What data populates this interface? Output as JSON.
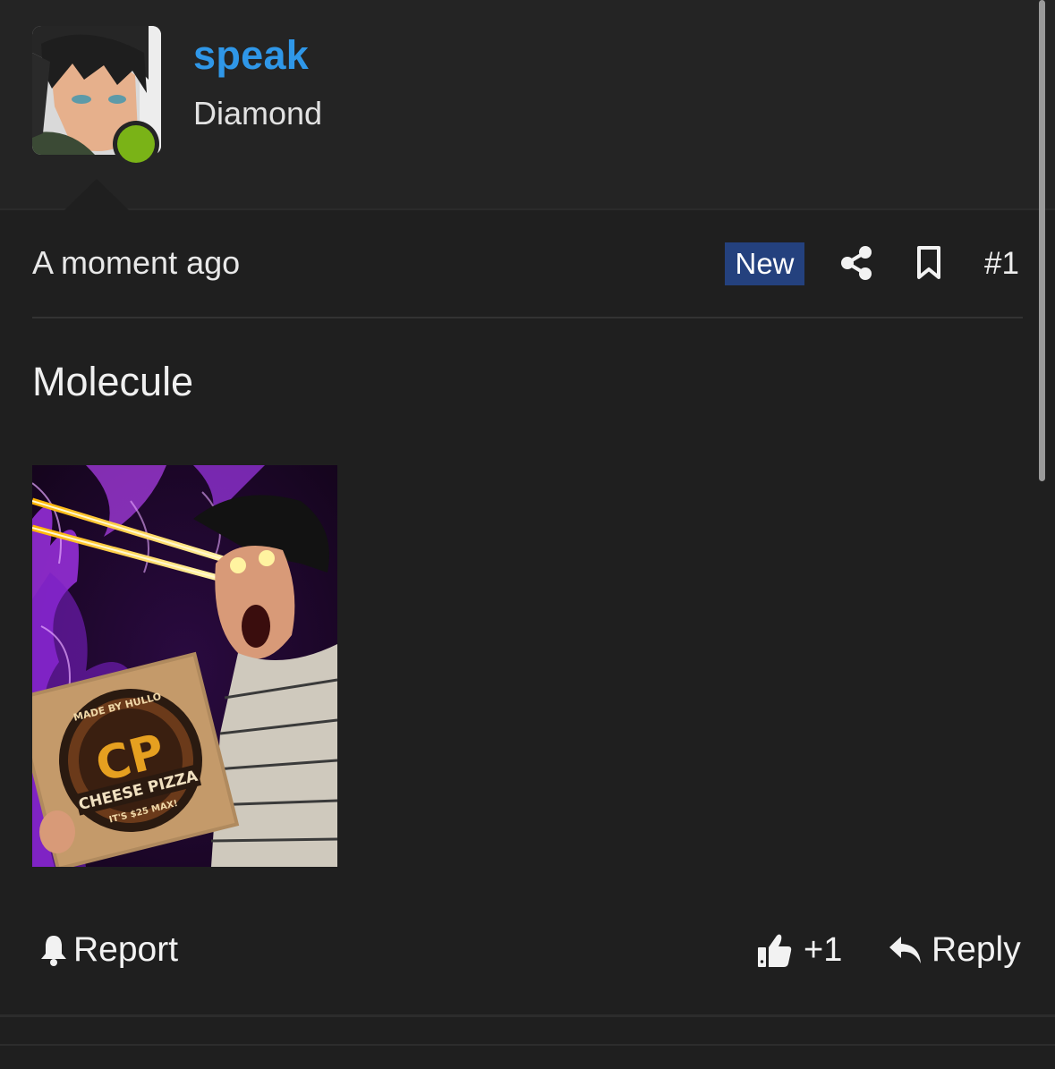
{
  "author": {
    "username": "speak",
    "rank": "Diamond",
    "online": true
  },
  "post": {
    "timestamp": "A moment ago",
    "badge": "New",
    "number": "#1",
    "text": "Molecule"
  },
  "attachment": {
    "image_text": [
      "MADE BY HULLO",
      "CP",
      "CHEESE PIZZA",
      "IT'S $25 MAX!"
    ]
  },
  "actions": {
    "report_label": "Report",
    "like_count": "+1",
    "reply_label": "Reply"
  },
  "icons": {
    "share": "share-icon",
    "bookmark": "bookmark-icon",
    "bell": "bell-icon",
    "thumbs_up": "thumbs-up-icon",
    "reply": "reply-icon"
  },
  "colors": {
    "background": "#1f1f1f",
    "header_background": "#242424",
    "username": "#2f97e8",
    "online_indicator": "#7ab317",
    "new_badge": "#24417e"
  }
}
